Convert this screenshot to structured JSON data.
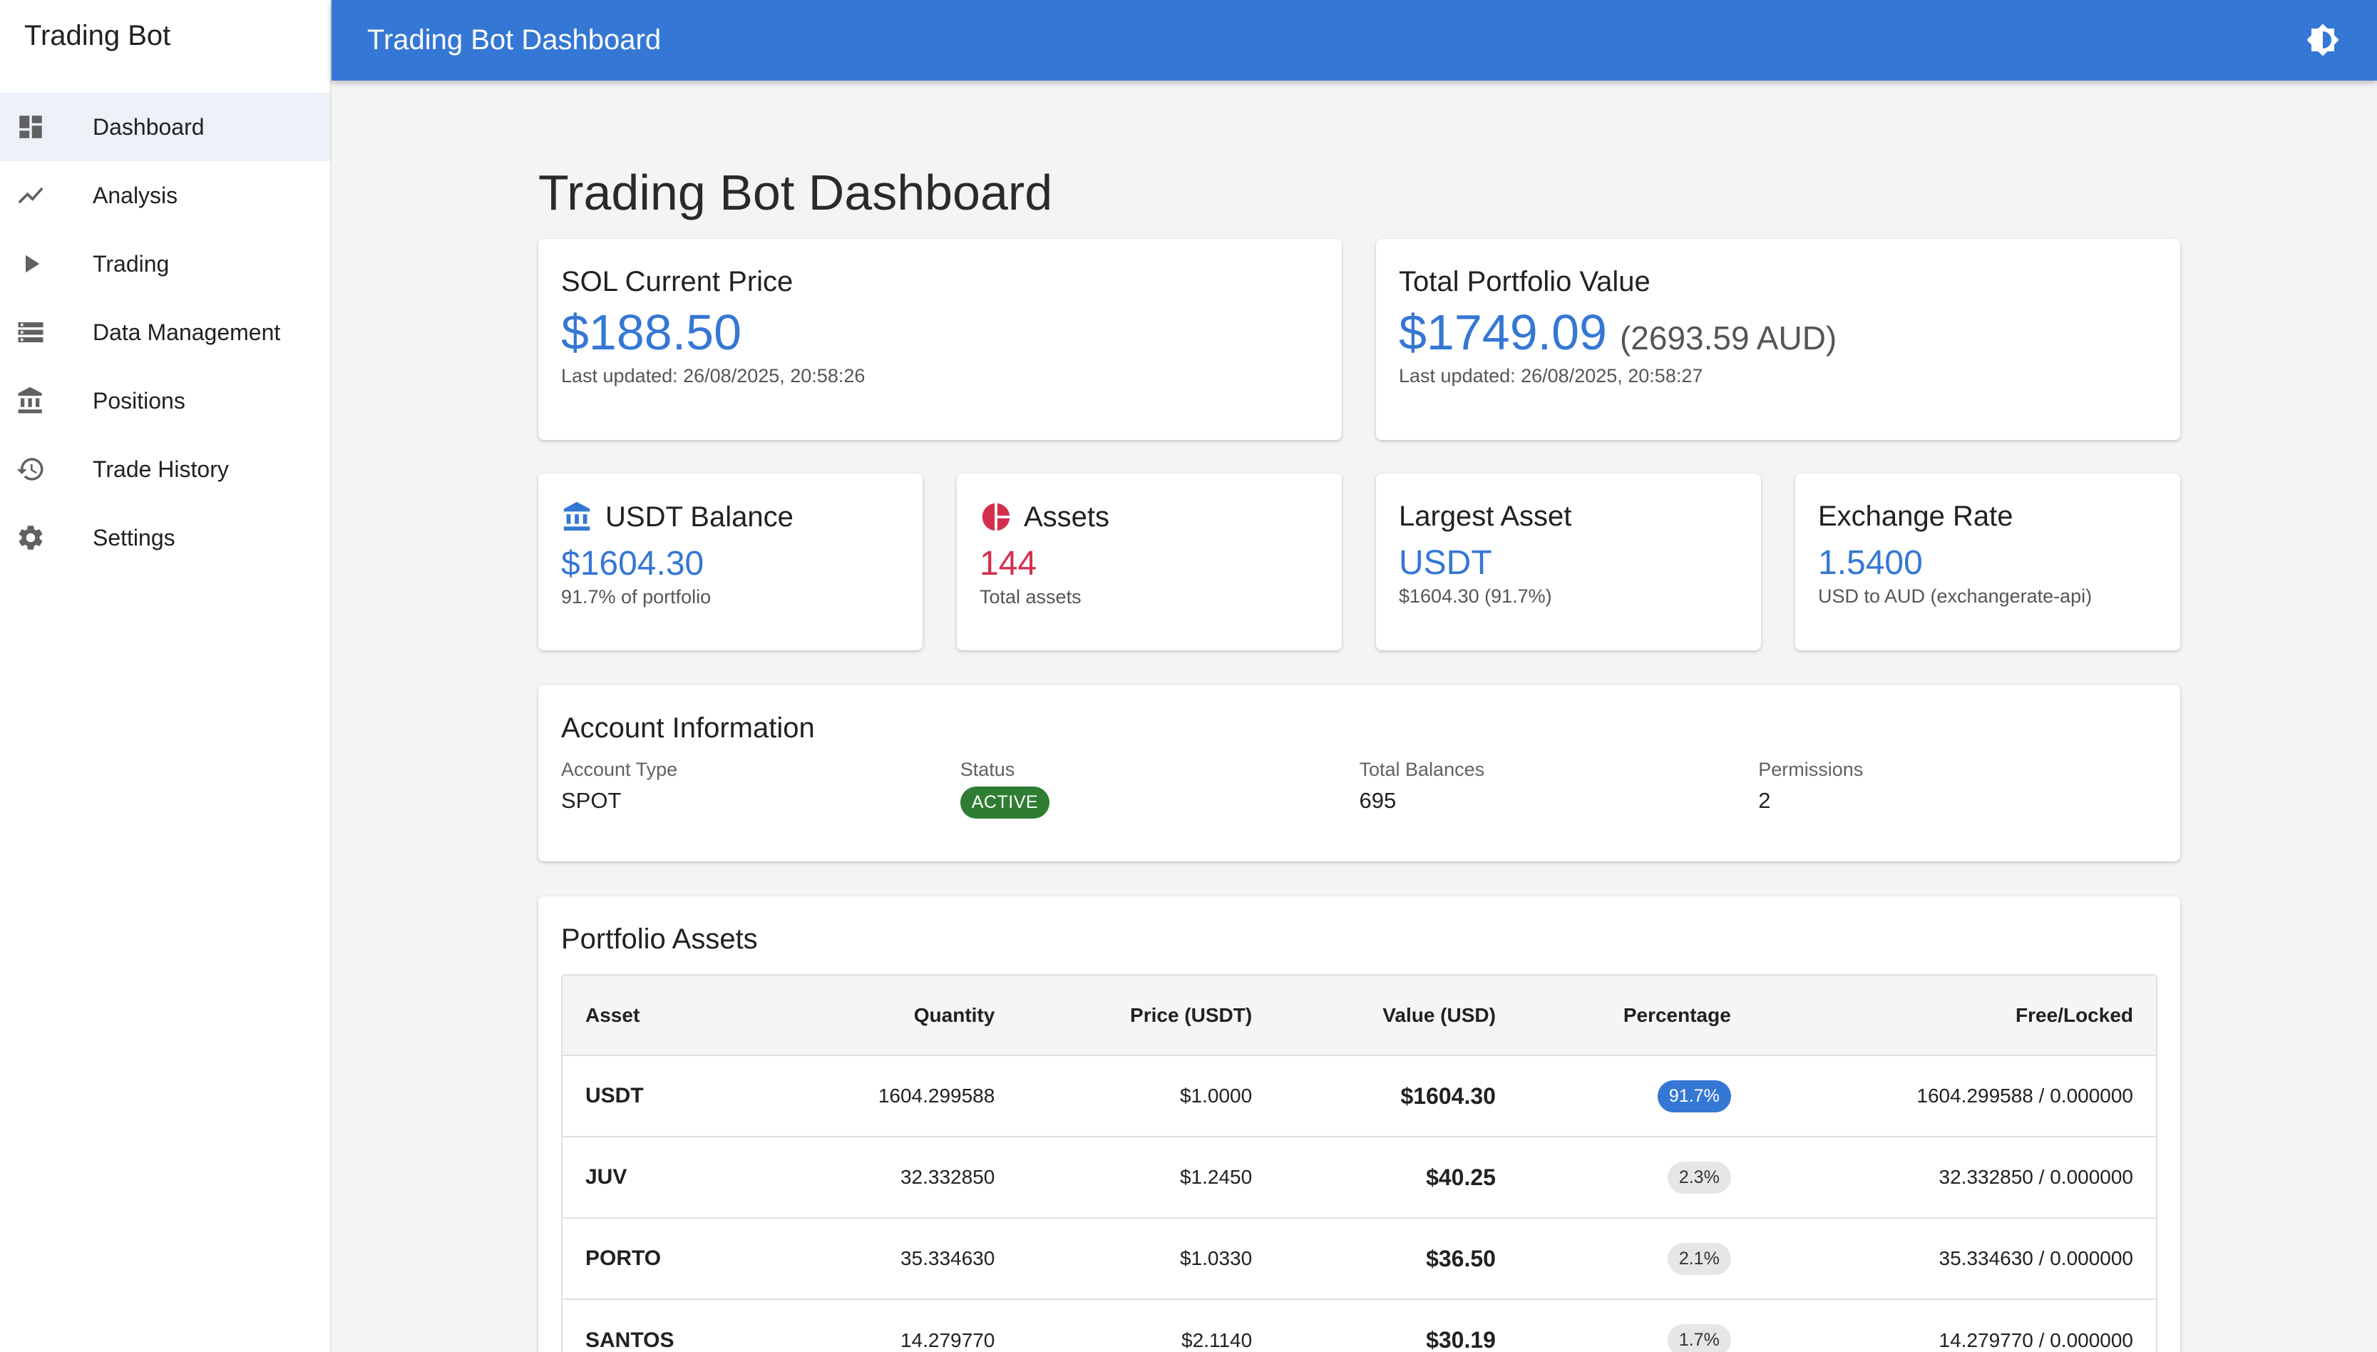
{
  "app": {
    "brand": "Trading Bot",
    "topbar_title": "Trading Bot Dashboard"
  },
  "sidebar": {
    "items": [
      {
        "label": "Dashboard",
        "icon": "dashboard-icon",
        "active": true
      },
      {
        "label": "Analysis",
        "icon": "trending-icon"
      },
      {
        "label": "Trading",
        "icon": "play-icon"
      },
      {
        "label": "Data Management",
        "icon": "storage-icon"
      },
      {
        "label": "Positions",
        "icon": "bank-icon"
      },
      {
        "label": "Trade History",
        "icon": "history-icon"
      },
      {
        "label": "Settings",
        "icon": "gear-icon"
      }
    ]
  },
  "page": {
    "title": "Trading Bot Dashboard"
  },
  "sol_card": {
    "title": "SOL Current Price",
    "price": "$188.50",
    "updated": "Last updated: 26/08/2025, 20:58:26"
  },
  "portfolio_card": {
    "title": "Total Portfolio Value",
    "value": "$1749.09",
    "aud": "(2693.59 AUD)",
    "updated": "Last updated: 26/08/2025, 20:58:27"
  },
  "stats": {
    "usdt": {
      "title": "USDT Balance",
      "value": "$1604.30",
      "sub": "91.7% of portfolio"
    },
    "assets": {
      "title": "Assets",
      "value": "144",
      "sub": "Total assets"
    },
    "largest": {
      "title": "Largest Asset",
      "value": "USDT",
      "sub": "$1604.30 (91.7%)"
    },
    "exchange": {
      "title": "Exchange Rate",
      "value": "1.5400",
      "sub": "USD to AUD (exchangerate-api)"
    }
  },
  "account": {
    "title": "Account Information",
    "fields": [
      {
        "label": "Account Type",
        "value": "SPOT"
      },
      {
        "label": "Status",
        "value": "ACTIVE"
      },
      {
        "label": "Total Balances",
        "value": "695"
      },
      {
        "label": "Permissions",
        "value": "2"
      }
    ]
  },
  "portfolio_assets": {
    "title": "Portfolio Assets",
    "columns": [
      "Asset",
      "Quantity",
      "Price (USDT)",
      "Value (USD)",
      "Percentage",
      "Free/Locked"
    ],
    "rows": [
      {
        "asset": "USDT",
        "quantity": "1604.299588",
        "price": "$1.0000",
        "value": "$1604.30",
        "pct": "91.7%",
        "free_locked": "1604.299588 / 0.000000"
      },
      {
        "asset": "JUV",
        "quantity": "32.332850",
        "price": "$1.2450",
        "value": "$40.25",
        "pct": "2.3%",
        "free_locked": "32.332850 / 0.000000"
      },
      {
        "asset": "PORTO",
        "quantity": "35.334630",
        "price": "$1.0330",
        "value": "$36.50",
        "pct": "2.1%",
        "free_locked": "35.334630 / 0.000000"
      },
      {
        "asset": "SANTOS",
        "quantity": "14.279770",
        "price": "$2.1140",
        "value": "$30.19",
        "pct": "1.7%",
        "free_locked": "14.279770 / 0.000000"
      }
    ]
  },
  "colors": {
    "primary": "#3577d4",
    "accent_red": "#d32f4d",
    "status_active": "#2e7d32"
  }
}
